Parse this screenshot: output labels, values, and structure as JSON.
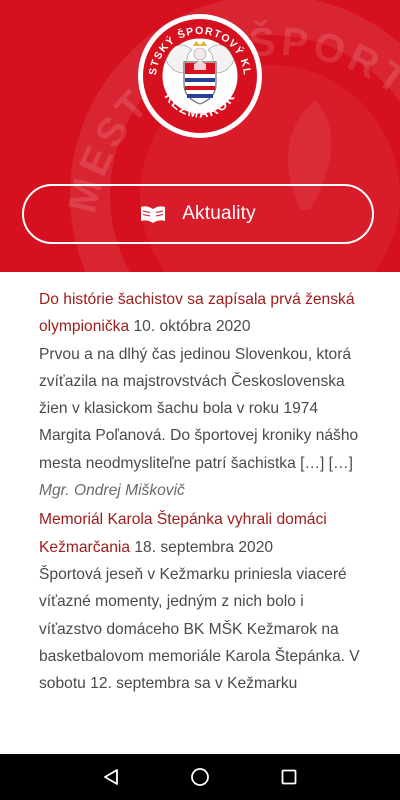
{
  "header": {
    "logo_text_top": "MESTSKÝ ŠPORTOVÝ KLUB",
    "logo_text_bottom": "KEŽMAROK",
    "watermark_text": "MESTSKÝ ŠPORTOVÝ KLUB",
    "menu_label": "Aktuality",
    "menu_icon": "book-icon",
    "brand_color": "#d6101e"
  },
  "posts": [
    {
      "title": "Do histórie šachistov sa zapísala prvá ženská olympionička",
      "date": "10. októbra 2020",
      "excerpt": "Prvou a na dlhý čas jedinou Slovenkou, ktorá zvíťazila na majstrovstvách Československa žien v klasickom šachu bola v roku 1974 Margita Poľanová. Do športovej kroniky nášho mesta neodmysliteľne patrí šachistka […] […]",
      "author": "Mgr. Ondrej Miškovič"
    },
    {
      "title": "Memoriál Karola Štepánka vyhrali domáci Kežmarčania",
      "date": "18. septembra 2020",
      "excerpt": "Športová jeseň v Kežmarku priniesla viaceré víťazné momenty, jedným z nich bolo i víťazstvo domáceho BK MŠK Kežmarok na basketbalovom memoriále Karola Štepánka. V sobotu 12. septembra sa v Kežmarku"
    }
  ],
  "navbar": {
    "back_icon": "back-triangle-icon",
    "home_icon": "home-circle-icon",
    "recents_icon": "recents-square-icon"
  }
}
